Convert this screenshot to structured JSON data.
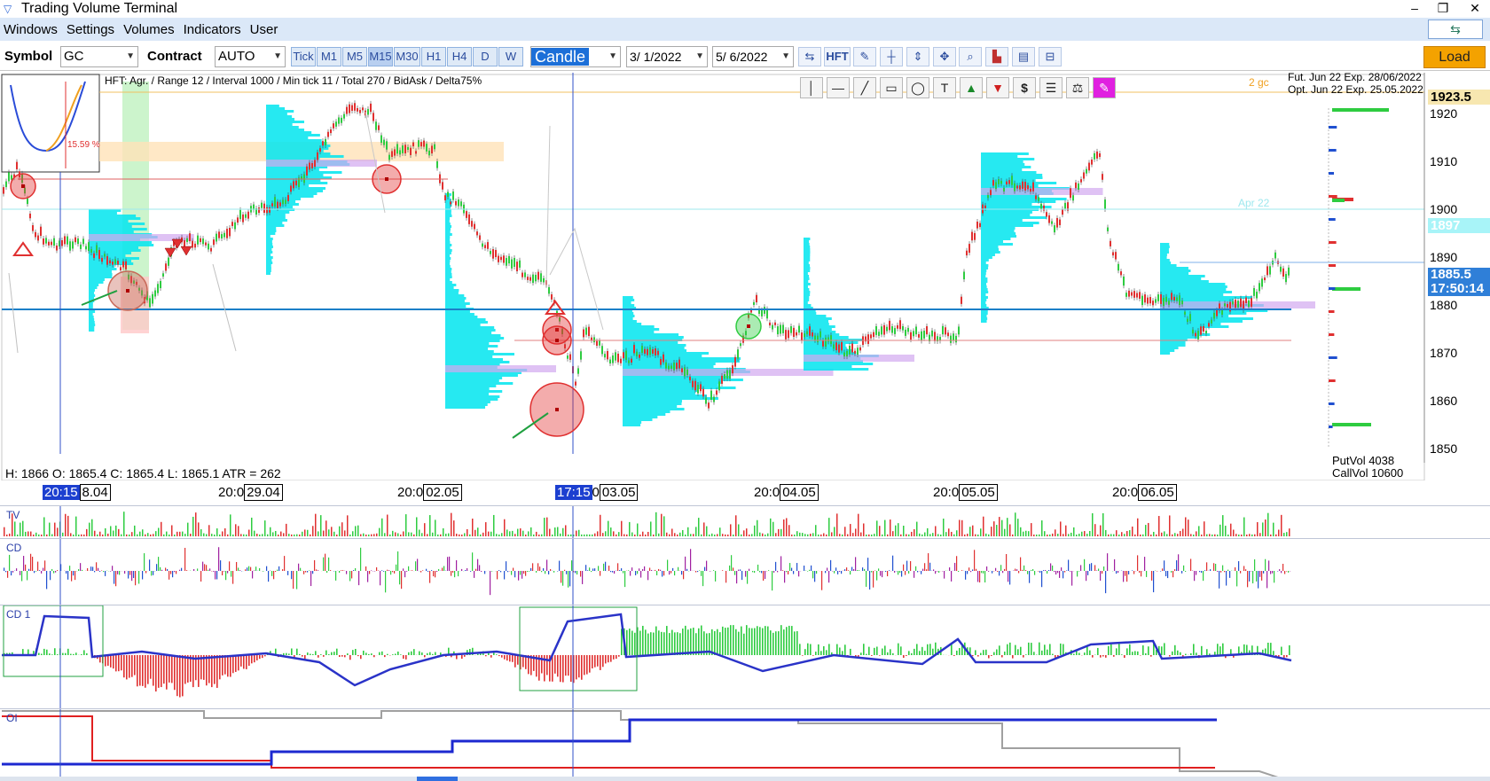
{
  "window": {
    "title": "Trading Volume Terminal",
    "minimize": "–",
    "restore": "❐",
    "close": "✕",
    "restore_btn": "⇆"
  },
  "menu": [
    "Windows",
    "Settings",
    "Volumes",
    "Indicators",
    "User"
  ],
  "toolbar": {
    "symbol_label": "Symbol",
    "symbol_value": "GC",
    "contract_label": "Contract",
    "contract_value": "AUTO",
    "timeframes": [
      "Tick",
      "M1",
      "M5",
      "M15",
      "M30",
      "H1",
      "H4",
      "D",
      "W"
    ],
    "active_timeframe": "M15",
    "chart_type": "Candle",
    "date_from": "3/ 1/2022",
    "date_to": "5/ 6/2022",
    "hft_label": "HFT",
    "load_label": "Load"
  },
  "chart": {
    "info_text": "HFT: Agr. / Range 12 / Interval 1000 / Min tick 11 / Total 270 / BidAsk / Delta75%",
    "label_2gc": "2 gc",
    "futures_line": "Fut. Jun 22 Exp. 28/06/2022",
    "options_line": "Opt. Jun 22 Exp. 25.05.2022",
    "apr_label": "Apr 22",
    "inset_pct": "15.59 %",
    "ohlc_text": "H: 1866   O: 1865.4   C: 1865.4   L: 1865.1   ATR = 262",
    "price_tag_top": "1923.5",
    "price_tag_line": "1897",
    "price_tag_current": "1885.5",
    "price_tag_time": "17:50:14",
    "putvol": "PutVol  4038",
    "callvol": "CallVol  10600",
    "y_labels": [
      "1920",
      "1910",
      "1900",
      "1890",
      "1880",
      "1870",
      "1860",
      "1850"
    ],
    "time_labels": [
      {
        "prefix": "",
        "sel": "20:15",
        "box": "8.04"
      },
      {
        "prefix": "20:0",
        "sel": "",
        "box": "29.04"
      },
      {
        "prefix": "20:0",
        "sel": "",
        "box": "02.05"
      },
      {
        "prefix": "",
        "sel": "17:15",
        "box": "03.05",
        "mid": "0"
      },
      {
        "prefix": "20:0",
        "sel": "",
        "box": "04.05"
      },
      {
        "prefix": "20:0",
        "sel": "",
        "box": "05.05"
      },
      {
        "prefix": "20:0",
        "sel": "",
        "box": "06.05"
      }
    ]
  },
  "panels": {
    "tv": "TV",
    "cd": "CD",
    "cd1": "CD 1",
    "oi": "OI"
  },
  "icons": [
    "arrows-icon",
    "pencil-icon",
    "crosshair-icon",
    "vertical-fit-icon",
    "move-icon",
    "zoom-icon",
    "levels-icon",
    "profile-icon",
    "range-icon"
  ],
  "colors": {
    "accent": "#f4a200",
    "profile": "#00e5ee",
    "buy": "#2ecc40",
    "sell": "#e03030",
    "cd_line": "#2a33c8"
  }
}
